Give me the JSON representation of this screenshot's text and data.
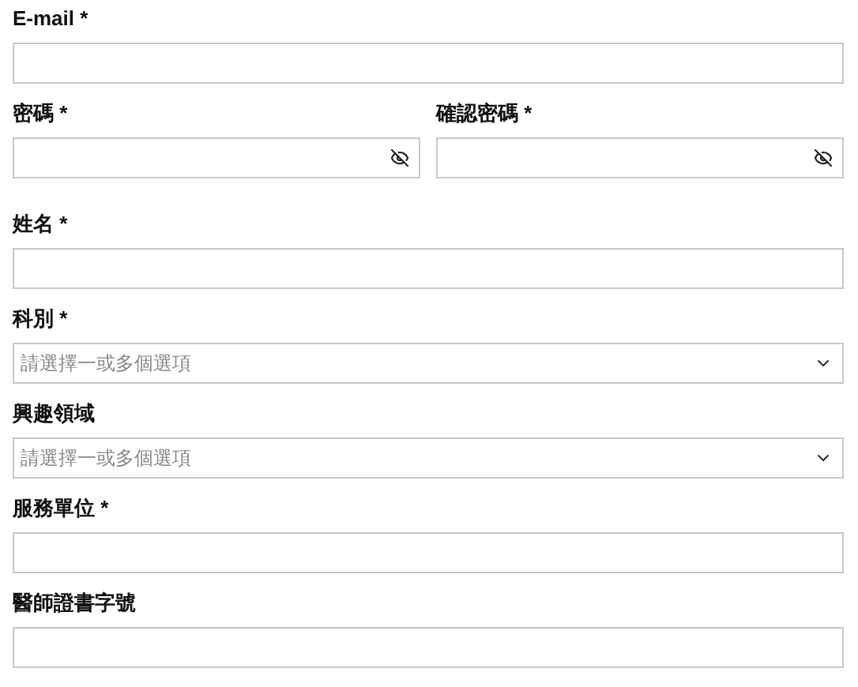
{
  "rows": [
    {
      "fields": [
        {
          "kind": "email",
          "label": "E-mail *"
        }
      ]
    },
    {
      "fields": [
        {
          "kind": "password",
          "label": "密碼 *"
        },
        {
          "kind": "password",
          "label": "確認密碼 *"
        }
      ]
    },
    {
      "fields": [
        {
          "kind": "text",
          "label": "姓名 *"
        }
      ]
    },
    {
      "fields": [
        {
          "kind": "select",
          "label": "科別 *",
          "placeholder": "請選擇一或多個選項"
        }
      ]
    },
    {
      "fields": [
        {
          "kind": "select",
          "label": "興趣領域",
          "placeholder": "請選擇一或多個選項"
        }
      ]
    },
    {
      "fields": [
        {
          "kind": "text",
          "label": "服務單位 *"
        }
      ]
    },
    {
      "fields": [
        {
          "kind": "text",
          "label": "醫師證書字號"
        }
      ]
    }
  ]
}
